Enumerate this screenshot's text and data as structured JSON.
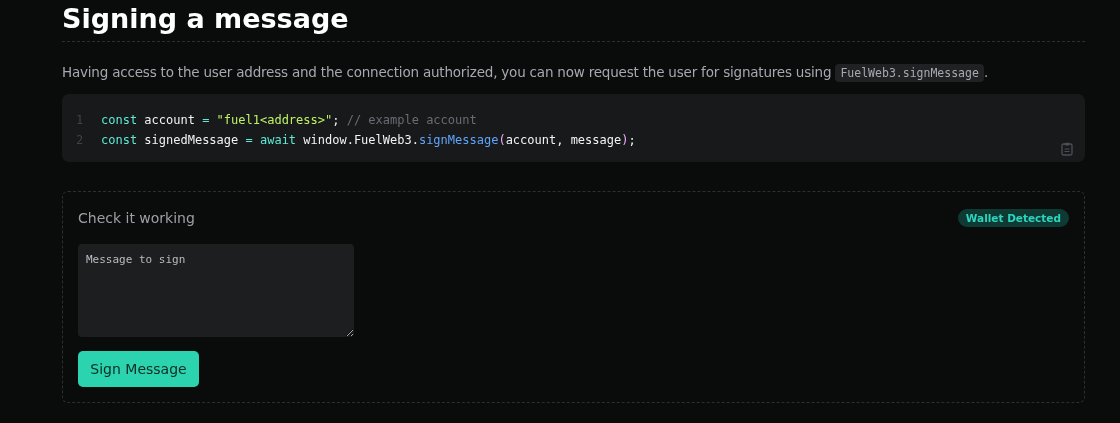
{
  "heading": "Signing a message",
  "intro": {
    "text": "Having access to the user address and the connection authorized, you can now request the user for signatures using ",
    "code": "FuelWeb3.signMessage",
    "after": "."
  },
  "code_block": {
    "lines": [
      {
        "number": "1",
        "tokens": [
          {
            "kind": "keyword",
            "text": "const"
          },
          {
            "kind": "plain",
            "text": " account "
          },
          {
            "kind": "operator",
            "text": "= "
          },
          {
            "kind": "string",
            "text": "\"fuel1<address>\""
          },
          {
            "kind": "plain",
            "text": "; "
          },
          {
            "kind": "comment",
            "text": "// example account"
          }
        ]
      },
      {
        "number": "2",
        "tokens": [
          {
            "kind": "keyword",
            "text": "const"
          },
          {
            "kind": "plain",
            "text": " signedMessage "
          },
          {
            "kind": "operator",
            "text": "= "
          },
          {
            "kind": "keyword",
            "text": "await"
          },
          {
            "kind": "plain",
            "text": " window.FuelWeb3."
          },
          {
            "kind": "function",
            "text": "signMessage"
          },
          {
            "kind": "paren",
            "text": "("
          },
          {
            "kind": "plain",
            "text": "account, message"
          },
          {
            "kind": "paren",
            "text": ")"
          },
          {
            "kind": "plain",
            "text": ";"
          }
        ]
      }
    ]
  },
  "demo": {
    "title": "Check it working",
    "badge": "Wallet Detected",
    "message_field": {
      "placeholder": "Message to sign"
    },
    "button": "Sign Message"
  }
}
